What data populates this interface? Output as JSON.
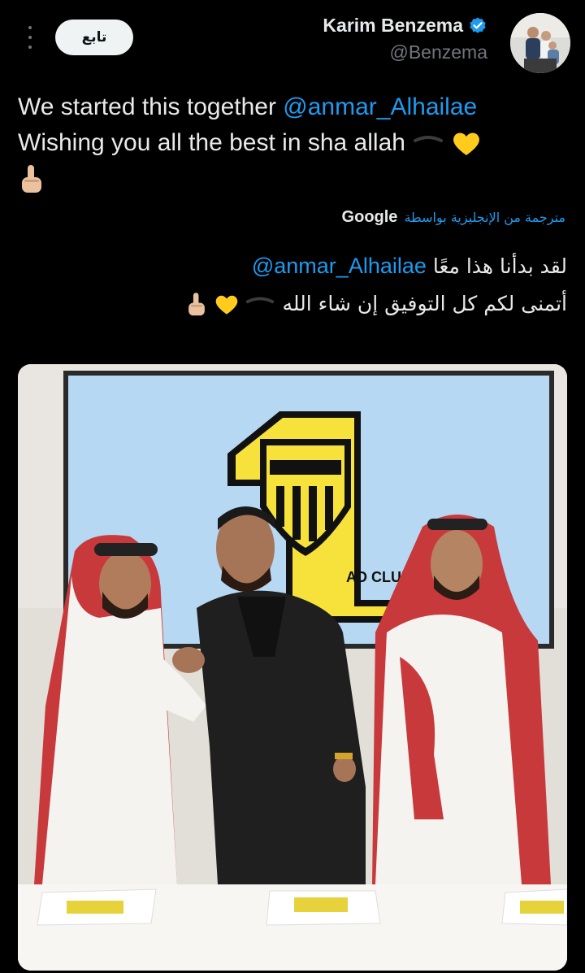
{
  "header": {
    "follow_label": "تابع",
    "author_name": "Karim Benzema",
    "author_handle": "@Benzema"
  },
  "tweet": {
    "line1_text": "We started this together ",
    "mention": "@anmar_Alhailae",
    "line2_text": "Wishing you all the best in sha allah"
  },
  "translation": {
    "label": "مترجمة من الإنجليزية بواسطة",
    "provider": "Google",
    "line1_text": "لقد بدأنا هذا معًا ",
    "mention": "@anmar_Alhailae",
    "line2_text": "أتمنى لكم كل التوفيق إن شاء الله"
  },
  "media": {
    "screen_logo_text": "AD CLUB"
  },
  "icons": {
    "more": "more-vertical-icon",
    "verified": "verified-badge-icon"
  },
  "colors": {
    "background": "#000000",
    "text": "#e7e9ea",
    "secondary_text": "#71767b",
    "link": "#1d9bf0",
    "verified": "#1d9bf0",
    "follow_button_bg": "#eff3f4",
    "club_yellow": "#f6e23a"
  }
}
